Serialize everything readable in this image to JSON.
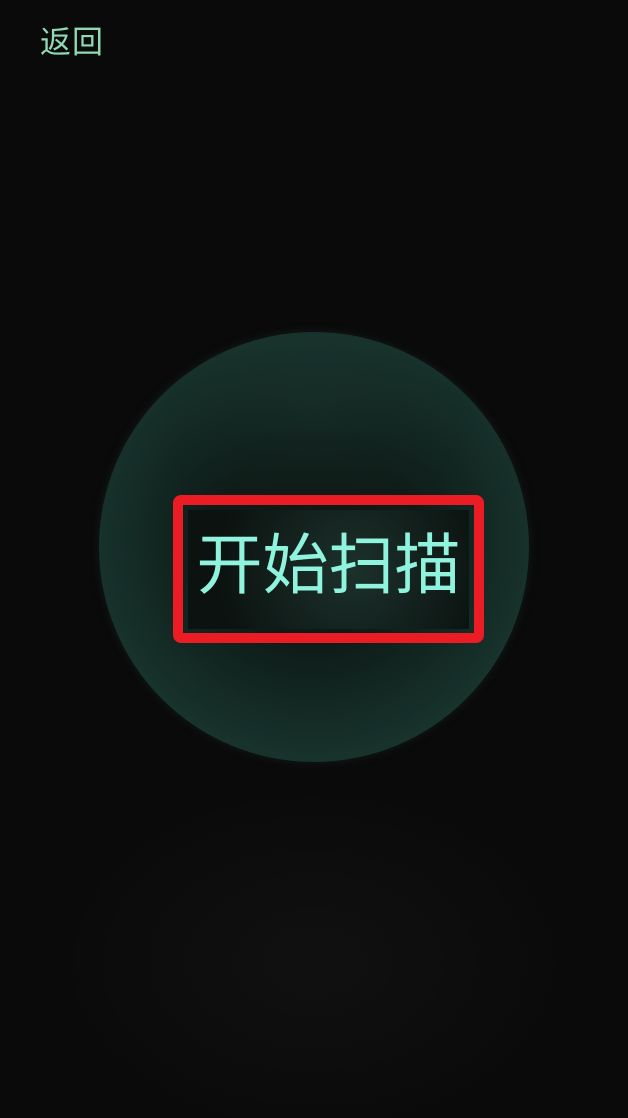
{
  "header": {
    "back_label": "返回"
  },
  "main": {
    "start_scan_label": "开始扫描"
  },
  "colors": {
    "background": "#0a0a0a",
    "back_text": "#8fd9b4",
    "button_text": "#8ff3de",
    "highlight_border": "#ec1c24",
    "circle": "#1e3e36"
  }
}
